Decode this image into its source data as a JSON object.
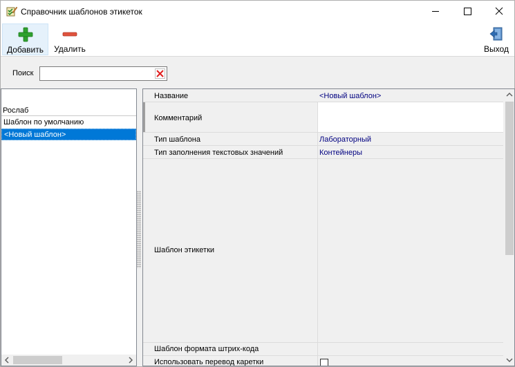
{
  "window": {
    "title": "Справочник шаблонов этикеток",
    "app_icon": "checklist-pencil-icon",
    "controls": [
      "minimize-icon",
      "maximize-icon",
      "close-icon"
    ]
  },
  "toolbar": {
    "add_label": "Добавить",
    "add_icon": "plus-icon",
    "delete_label": "Удалить",
    "delete_icon": "minus-icon",
    "exit_label": "Выход",
    "exit_icon": "exit-door-icon"
  },
  "search": {
    "label": "Поиск",
    "value": "",
    "clear_icon": "clear-x-icon"
  },
  "list": {
    "header": "Рослаб",
    "items": [
      {
        "label": "Шаблон по умолчанию",
        "selected": false
      },
      {
        "label": "<Новый шаблон>",
        "selected": true
      }
    ]
  },
  "properties": [
    {
      "name": "Название",
      "value": "<Новый шаблон>"
    },
    {
      "name": "Комментарий",
      "value": ""
    },
    {
      "name": "Тип шаблона",
      "value": "Лабораторный"
    },
    {
      "name": "Тип заполнения текстовых значений",
      "value": "Контейнеры"
    },
    {
      "name": "Шаблон этикетки",
      "value": ""
    },
    {
      "name": "Шаблон формата штрих-кода",
      "value": ""
    },
    {
      "name": "Использовать перевод каретки",
      "value": false
    }
  ],
  "colors": {
    "selection": "#0078d7",
    "value_text": "#000080",
    "add_icon": "#2fa12f",
    "delete_icon": "#e0533d",
    "clear_icon": "#e02020"
  }
}
